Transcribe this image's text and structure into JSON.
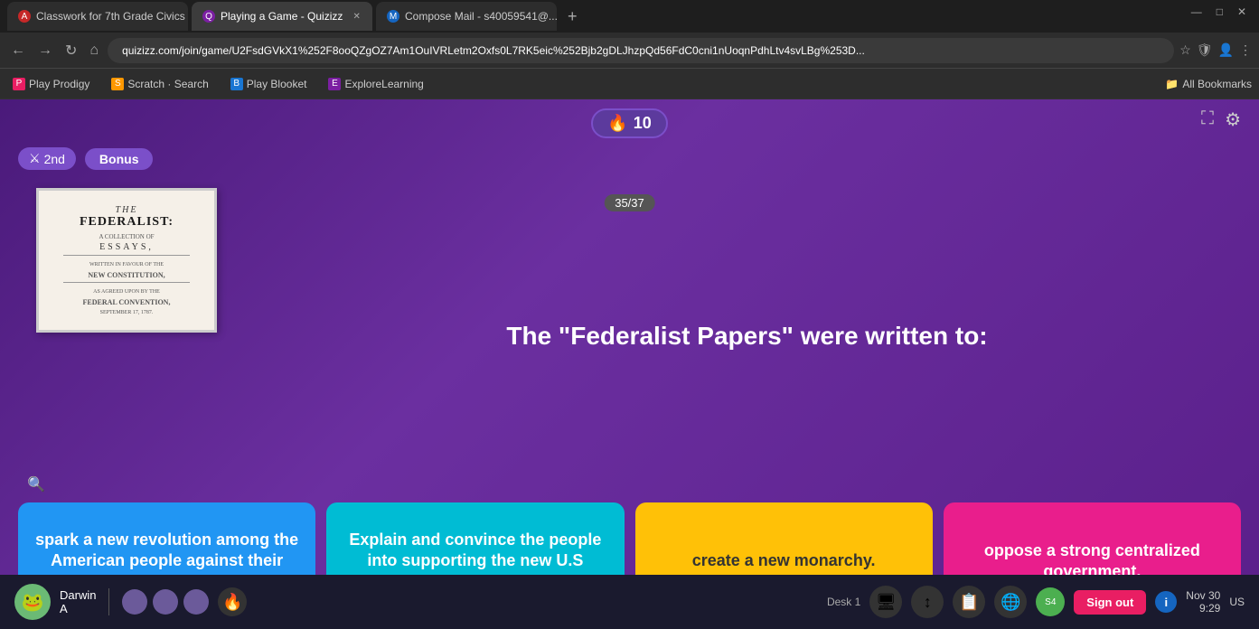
{
  "browser": {
    "tabs": [
      {
        "id": "tab1",
        "label": "Classwork for 7th Grade Civics",
        "icon": "A",
        "icon_color": "#c62828",
        "active": false,
        "favicon_bg": "#c62828"
      },
      {
        "id": "tab2",
        "label": "Playing a Game - Quizizz",
        "icon": "Q",
        "icon_color": "#9c27b0",
        "active": true,
        "favicon_bg": "#7b1fa2"
      },
      {
        "id": "tab3",
        "label": "Compose Mail - s40059541@...",
        "icon": "M",
        "icon_color": "#1565c0",
        "active": false,
        "favicon_bg": "#1565c0"
      }
    ],
    "new_tab_label": "+",
    "url": "quizizz.com/join/game/U2FsdGVkX1%252F8ooQZgOZ7Am1OuIVRLetm2Oxfs0L7RK5eic%252Bjb2gDLJhzpQd56FdC0cni1nUoqnPdhLtv4svLBg%253D...",
    "bookmarks": [
      {
        "label": "Play Prodigy",
        "icon": "P",
        "icon_color": "#e91e63"
      },
      {
        "label": "Scratch · Search",
        "icon": "S",
        "icon_color": "#ff9800"
      },
      {
        "label": "Play Blooket",
        "icon": "B",
        "icon_color": "#1976d2"
      },
      {
        "label": "ExploreLearning",
        "icon": "E",
        "icon_color": "#7b1fa2"
      }
    ],
    "all_bookmarks": "All Bookmarks",
    "window_controls": [
      "—",
      "□",
      "✕"
    ]
  },
  "game": {
    "score": "10",
    "score_label": "10",
    "flame_icon": "🔥",
    "player_rank": "2nd",
    "bonus_label": "Bonus",
    "progress": "35/37",
    "question": "The \"Federalist Papers\" were written to:",
    "image_alt": "Federalist Papers book cover",
    "federalist": {
      "line1": "THE",
      "title": "FEDERALIST:",
      "subtitle": "A COLLECTION OF",
      "essays": "ESSAYS,",
      "written": "WRITTEN IN FAVOUR OF THE",
      "new_const": "NEW CONSTITUTION,",
      "agreed": "AS AGREED UPON BY THE",
      "fed_conv": "FEDERAL CONVENTION,",
      "date": "SEPTEMBER 17, 1787."
    },
    "answers": [
      {
        "id": "a",
        "text": "spark a new revolution among the American people against their government.",
        "color": "blue"
      },
      {
        "id": "b",
        "text": "Explain and convince the people into supporting the new U.S Constitution.",
        "color": "teal"
      },
      {
        "id": "c",
        "text": "create a new monarchy.",
        "color": "yellow"
      },
      {
        "id": "d",
        "text": "oppose a strong centralized government.",
        "color": "pink"
      }
    ]
  },
  "taskbar": {
    "user_name": "Darwin",
    "user_sub": "A",
    "desk_label": "Desk 1",
    "signout_label": "Sign out",
    "date": "Nov 30",
    "time": "9:29",
    "region": "US"
  }
}
